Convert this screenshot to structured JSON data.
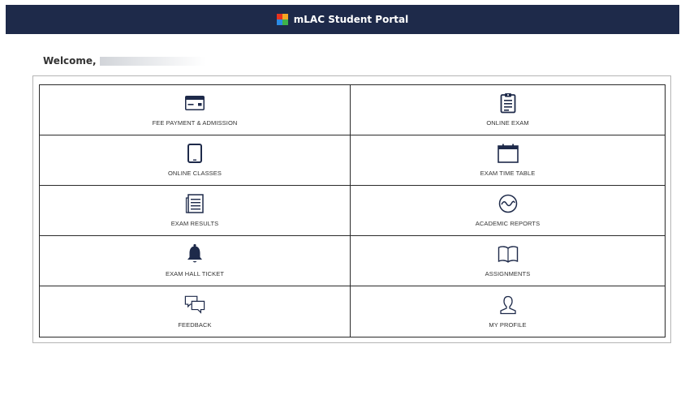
{
  "header": {
    "title": "mLAC Student Portal"
  },
  "welcome": {
    "greeting": "Welcome,"
  },
  "tiles": [
    {
      "label": "FEE PAYMENT & ADMISSION",
      "icon": "credit-card-icon"
    },
    {
      "label": "ONLINE EXAM",
      "icon": "clipboard-icon"
    },
    {
      "label": "ONLINE CLASSES",
      "icon": "tablet-icon"
    },
    {
      "label": "EXAM TIME TABLE",
      "icon": "calendar-icon"
    },
    {
      "label": "EXAM RESULTS",
      "icon": "document-list-icon"
    },
    {
      "label": "ACADEMIC REPORTS",
      "icon": "pulse-circle-icon"
    },
    {
      "label": "EXAM HALL TICKET",
      "icon": "bell-icon"
    },
    {
      "label": "ASSIGNMENTS",
      "icon": "open-book-icon"
    },
    {
      "label": "FEEDBACK",
      "icon": "chat-bubbles-icon"
    },
    {
      "label": "MY PROFILE",
      "icon": "user-icon"
    }
  ],
  "colors": {
    "header_bg": "#1e2a4a",
    "icon": "#1e2a4a",
    "border": "#2a2a2a"
  }
}
